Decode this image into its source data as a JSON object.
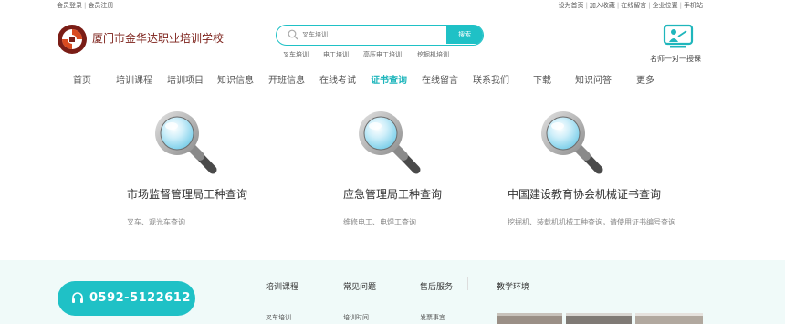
{
  "topbar": {
    "member_login": "会员登录",
    "member_register": "会员注册",
    "set_homepage": "设为首页",
    "add_favorite": "加入收藏",
    "online_message": "在线留言",
    "company_location": "企业位置",
    "mobile_site": "手机站"
  },
  "logo": {
    "name": "厦门市金华达职业培训学校",
    "colors": {
      "brand": "#7a1d16",
      "accent": "#d94a1f"
    }
  },
  "search": {
    "placeholder": "叉车培训",
    "button_label": "搜索",
    "hot_keywords": [
      "叉车培训",
      "电工培训",
      "高压电工培训",
      "挖掘机培训"
    ]
  },
  "tutor": {
    "label": "名师一对一授课",
    "icon": "teacher-board-icon"
  },
  "nav": {
    "items": [
      "首页",
      "培训课程",
      "培训项目",
      "知识信息",
      "开班信息",
      "在线考试",
      "证书查询",
      "在线留言",
      "联系我们",
      "下载",
      "知识问答",
      "更多"
    ],
    "active": "证书查询",
    "active_color": "#1fb6bc"
  },
  "cards": [
    {
      "title": "市场监督管理局工种查询",
      "desc": "叉车、观光车查询",
      "icon": "magnifier-icon"
    },
    {
      "title": "应急管理局工种查询",
      "desc": "维修电工、电焊工查询",
      "icon": "magnifier-icon"
    },
    {
      "title": "中国建设教育协会机械证书查询",
      "desc": "挖掘机、装载机机械工种查询，请使用证书编号查询",
      "icon": "magnifier-icon"
    }
  ],
  "footer": {
    "phone": "0592-5122612",
    "columns": [
      {
        "heading": "培训课程",
        "first_item": "叉车培训"
      },
      {
        "heading": "常见问题",
        "first_item": "培训时间"
      },
      {
        "heading": "售后服务",
        "first_item": "发票事宜"
      },
      {
        "heading": "教学环境"
      }
    ],
    "accent": "#1fc1c6"
  }
}
